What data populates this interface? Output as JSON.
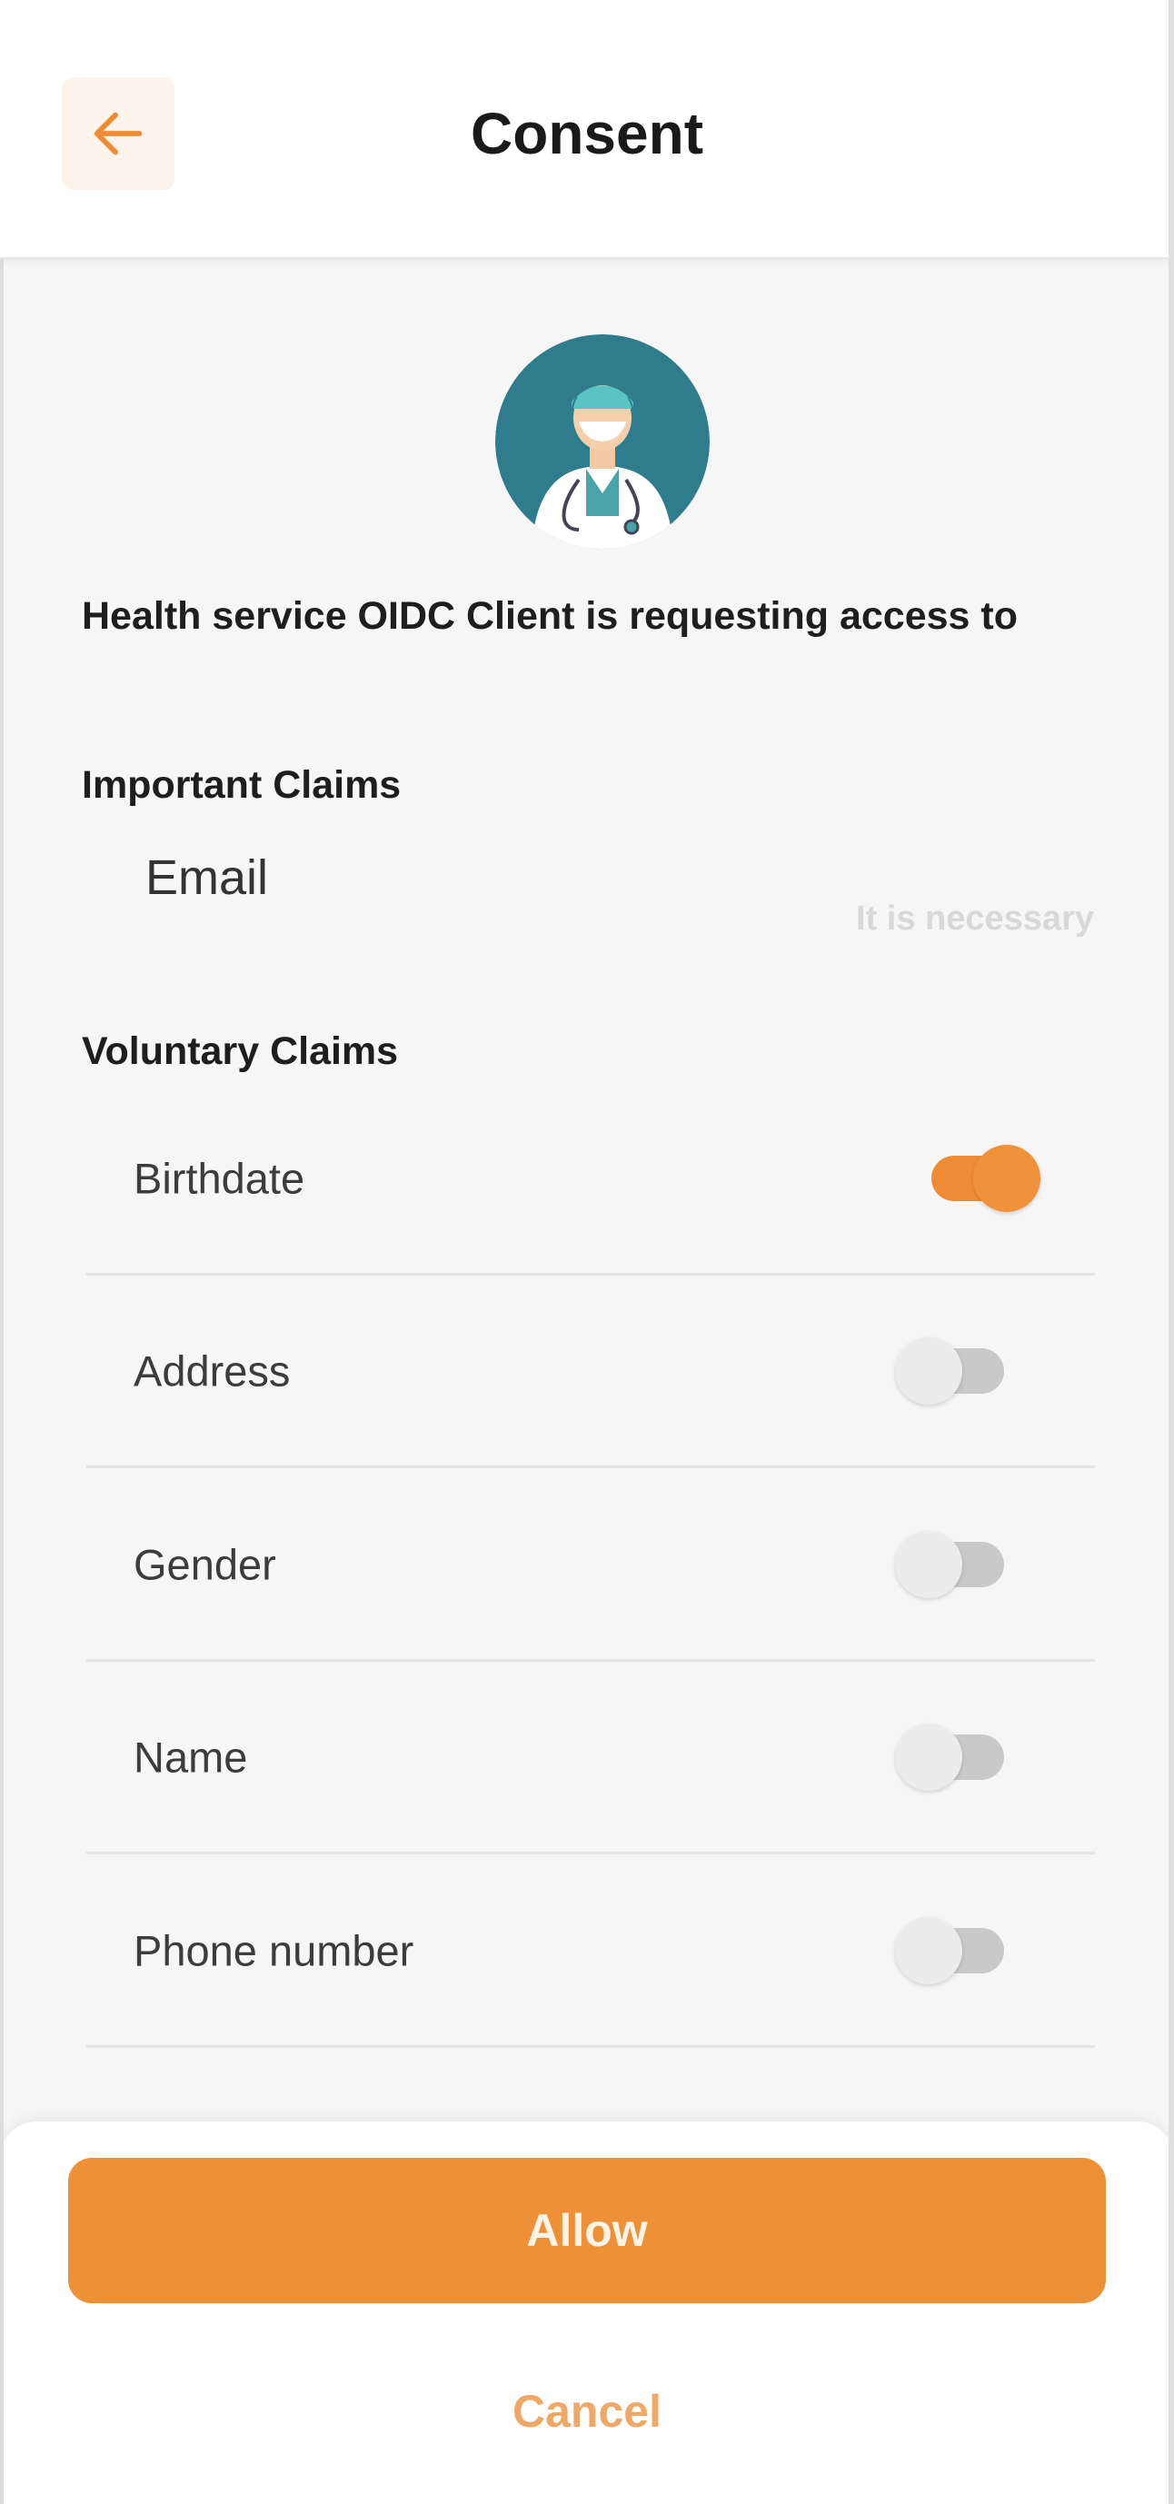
{
  "header": {
    "title": "Consent",
    "back_icon": "arrow-left-icon"
  },
  "client": {
    "avatar_icon": "doctor-avatar-icon",
    "request_text": "Health service OIDC Client  is requesting access to"
  },
  "important_claims": {
    "title": "Important Claims",
    "items": [
      {
        "label": "Email",
        "note": "It is necessary"
      }
    ]
  },
  "voluntary_claims": {
    "title": "Voluntary Claims",
    "items": [
      {
        "label": "Birthdate",
        "enabled": true
      },
      {
        "label": "Address",
        "enabled": false
      },
      {
        "label": "Gender",
        "enabled": false
      },
      {
        "label": "Name",
        "enabled": false
      },
      {
        "label": "Phone number",
        "enabled": false
      }
    ]
  },
  "actions": {
    "allow_label": "Allow",
    "cancel_label": "Cancel"
  },
  "colors": {
    "accent": "#EE9035",
    "toggle_off": "#C9C9C9"
  }
}
